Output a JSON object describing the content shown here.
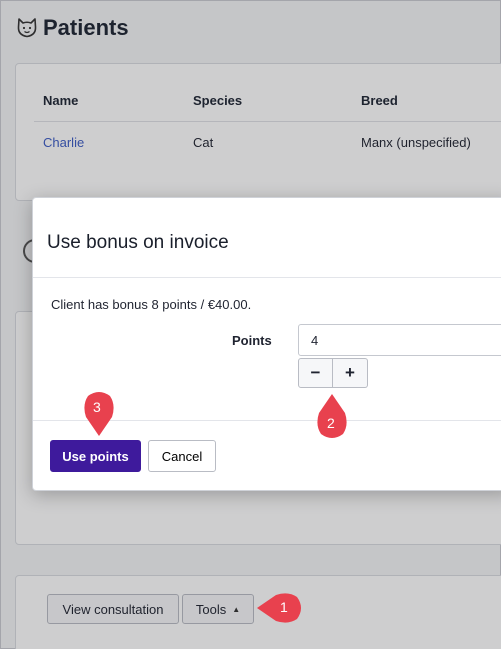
{
  "page": {
    "title": "Patients",
    "title_icon": "cat-icon"
  },
  "patients_table": {
    "headers": [
      "Name",
      "Species",
      "Breed"
    ],
    "rows": [
      {
        "name": "Charlie",
        "species": "Cat",
        "breed": "Manx (unspecified)"
      }
    ]
  },
  "actions": {
    "view_consultation": "View consultation",
    "tools": "Tools"
  },
  "modal": {
    "title": "Use bonus on invoice",
    "bonus_text": "Client has bonus 8 points / €40.00.",
    "points_label": "Points",
    "points_value": "4",
    "minus_label": "−",
    "plus_label": "+",
    "use_points_label": "Use points",
    "cancel_label": "Cancel"
  },
  "callouts": {
    "step_1": "1",
    "step_2": "2",
    "step_3": "3",
    "color": "#e8414e"
  },
  "colors": {
    "primary": "#3e1a9c",
    "link": "#3b5bc4"
  }
}
